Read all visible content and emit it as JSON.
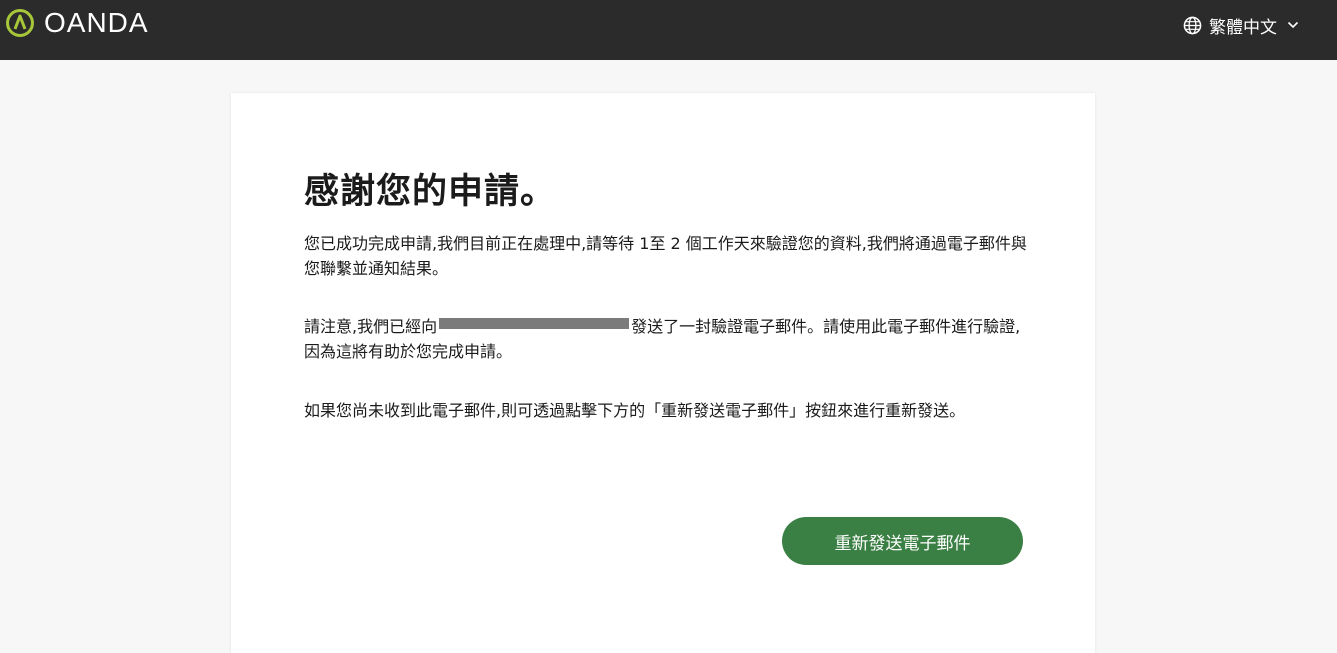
{
  "header": {
    "logo_text": "OANDA",
    "language_label": "繁體中文",
    "icons": {
      "logo": "oanda-logo-icon",
      "language": "globe-icon",
      "dropdown": "chevron-down-icon"
    },
    "colors": {
      "bar": "#2b2b2b",
      "logo_accent": "#a8c63a"
    }
  },
  "card": {
    "title": "感謝您的申請。",
    "paragraph1": "您已成功完成申請,我們目前正在處理中,請等待 1至 2 個工作天來驗證您的資料,我們將通過電子郵件與您聯繫並通知結果。",
    "paragraph2_before": "請注意,我們已經向",
    "paragraph2_after": "發送了一封驗證電子郵件。請使用此電子郵件進行驗證,因為這將有助於您完成申請。",
    "paragraph3": "如果您尚未收到此電子郵件,則可透過點擊下方的「重新發送電子郵件」按鈕來進行重新發送。",
    "resend_button_label": "重新發送電子郵件",
    "colors": {
      "button": "#3a7f43"
    }
  }
}
